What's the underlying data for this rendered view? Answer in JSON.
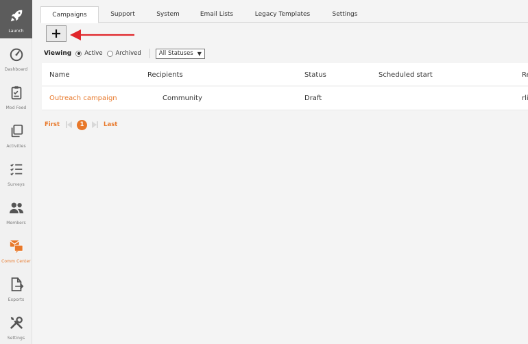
{
  "sidebar": {
    "items": [
      {
        "label": "Launch",
        "icon": "rocket-icon"
      },
      {
        "label": "Dashboard",
        "icon": "gauge-icon"
      },
      {
        "label": "Mod Feed",
        "icon": "clipboard-icon"
      },
      {
        "label": "Activities",
        "icon": "copy-icon"
      },
      {
        "label": "Surveys",
        "icon": "checklist-icon"
      },
      {
        "label": "Members",
        "icon": "people-icon"
      },
      {
        "label": "Comm Center",
        "icon": "mail-chat-icon"
      },
      {
        "label": "Exports",
        "icon": "export-icon"
      },
      {
        "label": "Settings",
        "icon": "tools-icon"
      }
    ]
  },
  "tabs": [
    "Campaigns",
    "Support",
    "System",
    "Email Lists",
    "Legacy Templates",
    "Settings"
  ],
  "viewing": {
    "label": "Viewing",
    "options": [
      "Active",
      "Archived"
    ],
    "selected": "Active",
    "status_select": "All Statuses"
  },
  "table": {
    "columns": [
      "Name",
      "Recipients",
      "Status",
      "Scheduled start",
      "Re"
    ],
    "rows": [
      {
        "name": "Outreach campaign",
        "recipients": "Community",
        "status": "Draft",
        "scheduled_start": "",
        "extra": "rli"
      }
    ]
  },
  "pagination": {
    "first": "First",
    "last": "Last",
    "current": "1"
  },
  "colors": {
    "accent": "#e8782a",
    "sidebar_active": "#5c5c5c",
    "arrow": "#e0262b"
  }
}
